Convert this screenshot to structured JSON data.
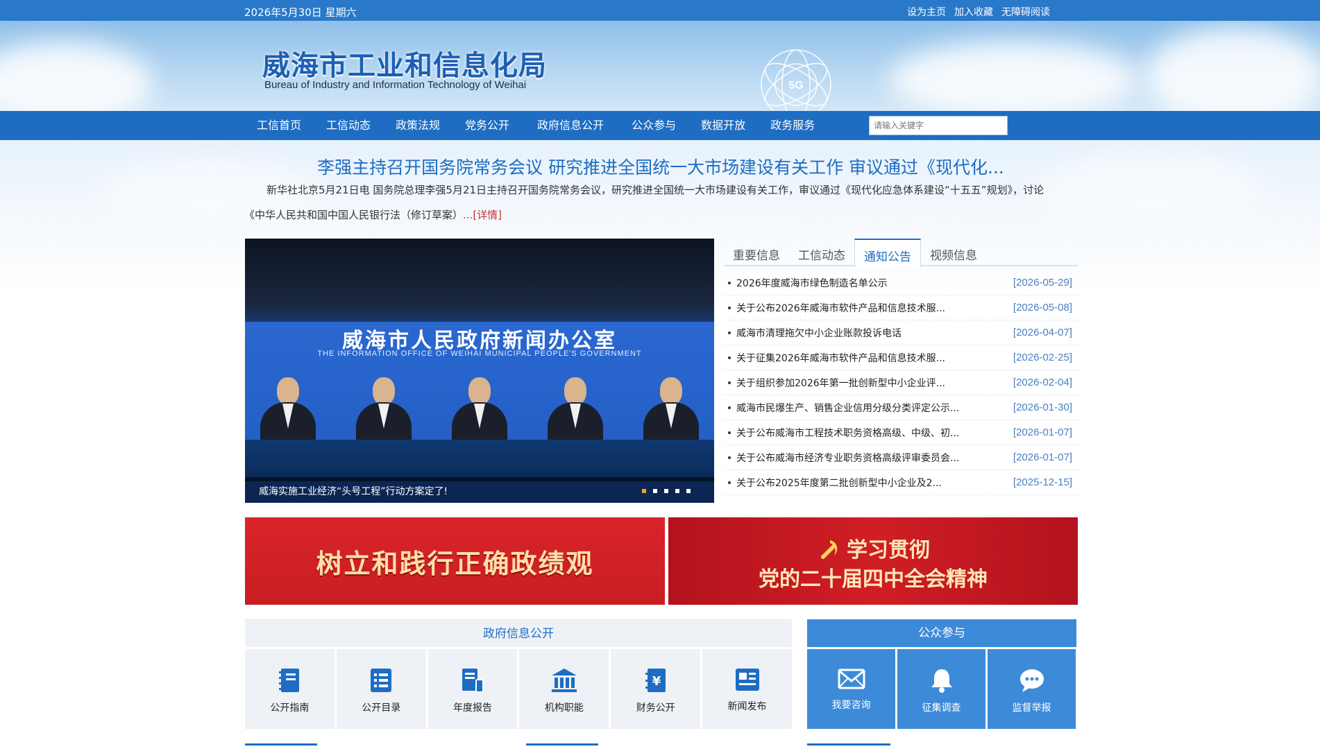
{
  "topbar": {
    "date": "2026年5月30日 星期六",
    "links": [
      "设为主页",
      "加入收藏",
      "无障碍阅读"
    ]
  },
  "header": {
    "title_cn": "威海市工业和信息化局",
    "title_en": "Bureau of Industry and Information Technology of Weihai",
    "globe_label": "5G"
  },
  "nav": {
    "items": [
      "工信首页",
      "工信动态",
      "政策法规",
      "党务公开",
      "政府信息公开",
      "公众参与",
      "数据开放",
      "政务服务"
    ],
    "search_placeholder": "请输入关键字"
  },
  "headline": {
    "title": "李强主持召开国务院常务会议 研究推进全国统一大市场建设有关工作 审议通过《现代化...",
    "summary": "新华社北京5月21日电 国务院总理李强5月21日主持召开国务院常务会议，研究推进全国统一大市场建设有关工作，审议通过《现代化应急体系建设“十五五”规划》，讨论《中华人民共和国中国人民银行法（修订草案）",
    "more": "...[详情]"
  },
  "slider": {
    "wall_title": "威海市人民政府新闻办公室",
    "wall_subtitle": "THE INFORMATION OFFICE OF WEIHAI MUNICIPAL PEOPLE'S GOVERNMENT",
    "caption": "威海实施工业经济“头号工程”行动方案定了!",
    "dot_count": 5,
    "active_dot": 1
  },
  "tabs": {
    "items": [
      "重要信息",
      "工信动态",
      "通知公告",
      "视频信息"
    ],
    "active": 3
  },
  "news": [
    {
      "title": "2026年度威海市绿色制造名单公示",
      "date": "[2026-05-29]"
    },
    {
      "title": "关于公布2026年威海市软件产品和信息技术服...",
      "date": "[2026-05-08]"
    },
    {
      "title": "威海市清理拖欠中小企业账款投诉电话",
      "date": "[2026-04-07]"
    },
    {
      "title": "关于征集2026年威海市软件产品和信息技术服...",
      "date": "[2026-02-25]"
    },
    {
      "title": "关于组织参加2026年第一批创新型中小企业评...",
      "date": "[2026-02-04]"
    },
    {
      "title": "威海市民爆生产、销售企业信用分级分类评定公示...",
      "date": "[2026-01-30]"
    },
    {
      "title": "关于公布威海市工程技术职务资格高级、中级、初...",
      "date": "[2026-01-07]"
    },
    {
      "title": "关于公布威海市经济专业职务资格高级评审委员会...",
      "date": "[2026-01-07]"
    },
    {
      "title": "关于公布2025年度第二批创新型中小企业及2...",
      "date": "[2025-12-15]"
    }
  ],
  "banners": {
    "left": "树立和践行正确政绩观",
    "right_line1": "学习贯彻",
    "right_line2": "党的二十届四中全会精神"
  },
  "gov_panel": {
    "title": "政府信息公开",
    "items": [
      {
        "label": "公开指南",
        "icon": "book-icon"
      },
      {
        "label": "公开目录",
        "icon": "list-icon"
      },
      {
        "label": "年度报告",
        "icon": "report-icon"
      },
      {
        "label": "机构职能",
        "icon": "institution-icon"
      },
      {
        "label": "财务公开",
        "icon": "finance-icon"
      },
      {
        "label": "新闻发布",
        "icon": "newspaper-icon"
      }
    ]
  },
  "public_panel": {
    "title": "公众参与",
    "items": [
      {
        "label": "我要咨询",
        "icon": "mail-icon"
      },
      {
        "label": "征集调查",
        "icon": "bell-icon"
      },
      {
        "label": "监督举报",
        "icon": "chat-icon"
      }
    ]
  },
  "colors": {
    "primary": "#1e6dc3",
    "topbar": "#2a79c9",
    "accent_red": "#d03030",
    "date_blue": "#4a7ec0"
  }
}
